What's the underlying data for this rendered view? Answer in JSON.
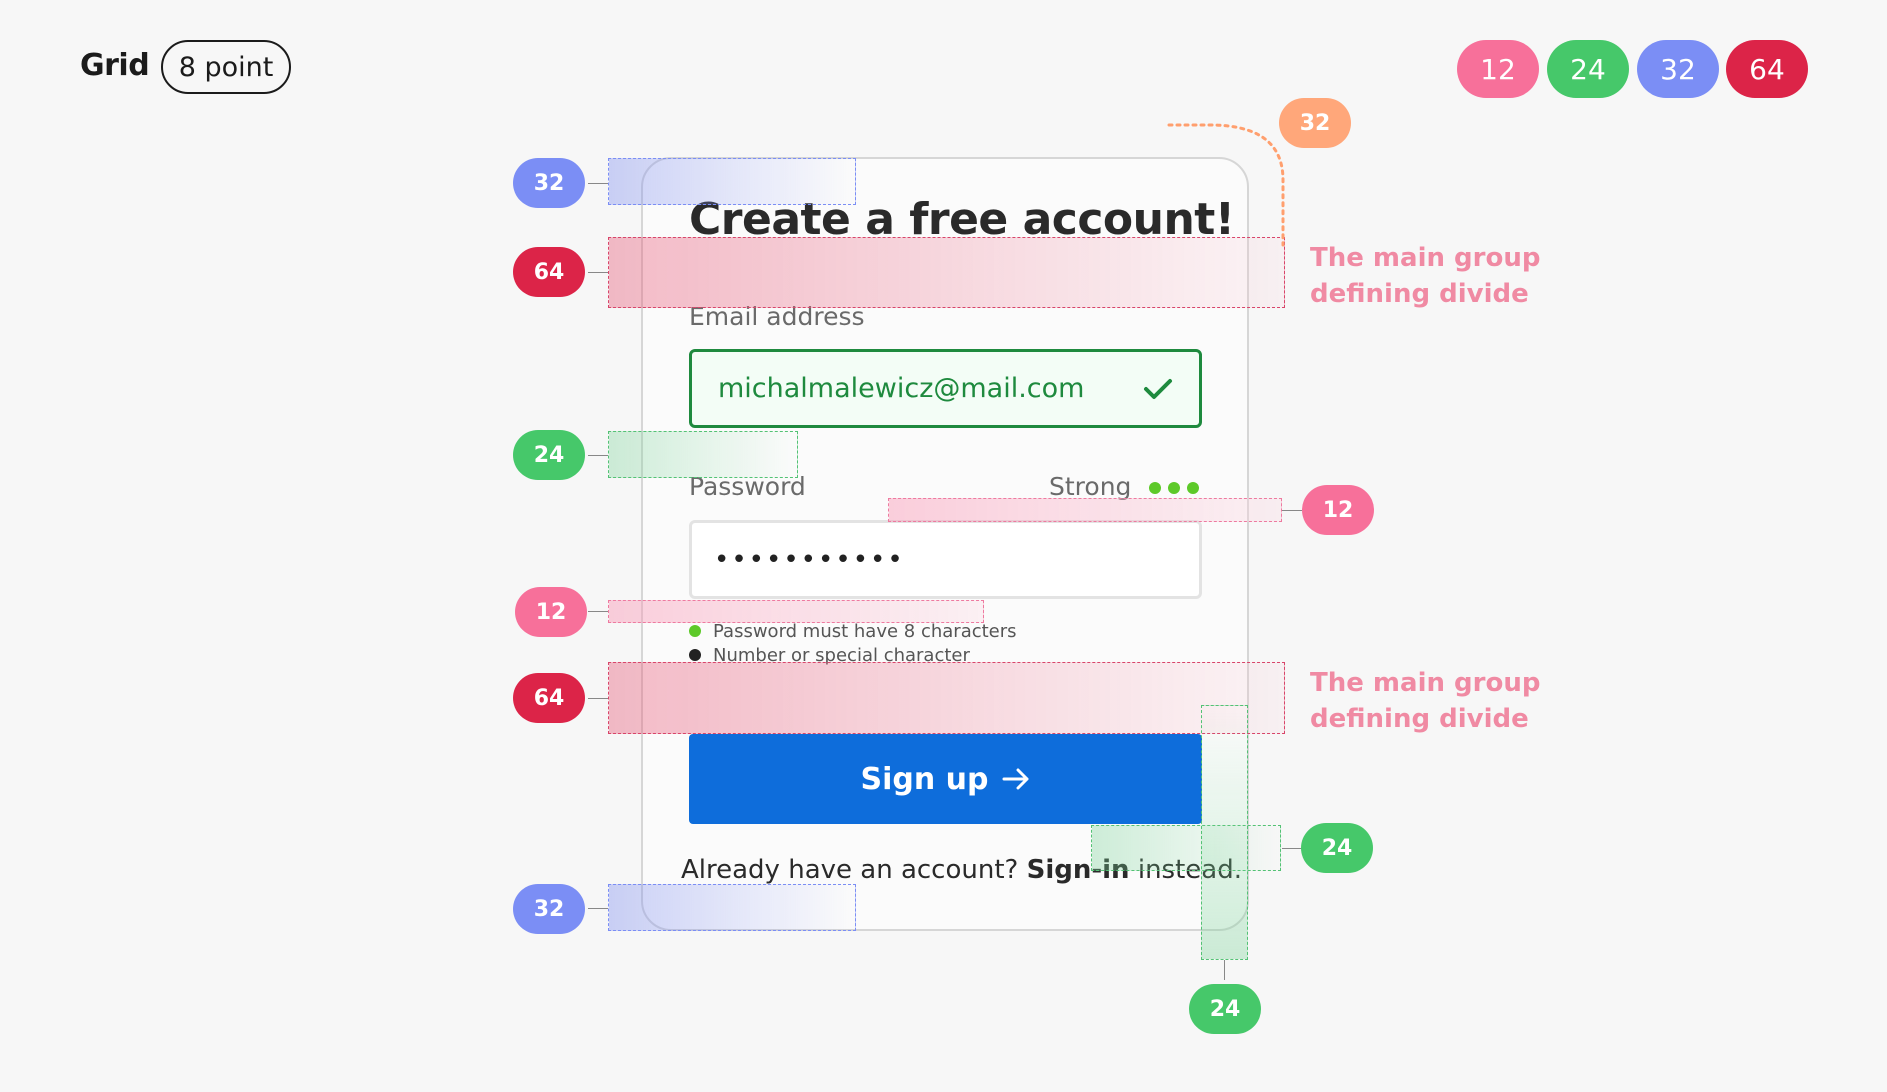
{
  "header": {
    "title": "Grid",
    "grid_pill": "8 point"
  },
  "legend": [
    {
      "label": "12",
      "color": "#f7709a"
    },
    {
      "label": "24",
      "color": "#46c86a"
    },
    {
      "label": "32",
      "color": "#7b8ef5"
    },
    {
      "label": "64",
      "color": "#dc2448"
    }
  ],
  "annotations": {
    "top_32": "32",
    "left_32_top": "32",
    "left_64_top": "64",
    "left_24": "24",
    "left_12": "12",
    "left_64_bottom": "64",
    "left_32_bottom": "32",
    "right_12": "12",
    "right_24": "24",
    "bottom_24": "24",
    "note_line1": "The main group",
    "note_line2": "defining divide"
  },
  "form": {
    "heading": "Create a free account!",
    "email_label": "Email address",
    "email_value": "michalmalewicz@mail.com",
    "password_label": "Password",
    "strength_label": "Strong",
    "password_value": "•••••••••••",
    "rules": [
      {
        "text": "Password must have 8 characters",
        "color": "#5dc929"
      },
      {
        "text": "Number or special character",
        "color": "#222222"
      }
    ],
    "signup_label": "Sign up",
    "footer_prefix": "Already have an account? ",
    "footer_link": "Sign-in",
    "footer_suffix": " instead."
  },
  "colors": {
    "accent_blue": "#0e6ddb",
    "success_green": "#1e8a3e",
    "strength_green": "#5dc929"
  }
}
